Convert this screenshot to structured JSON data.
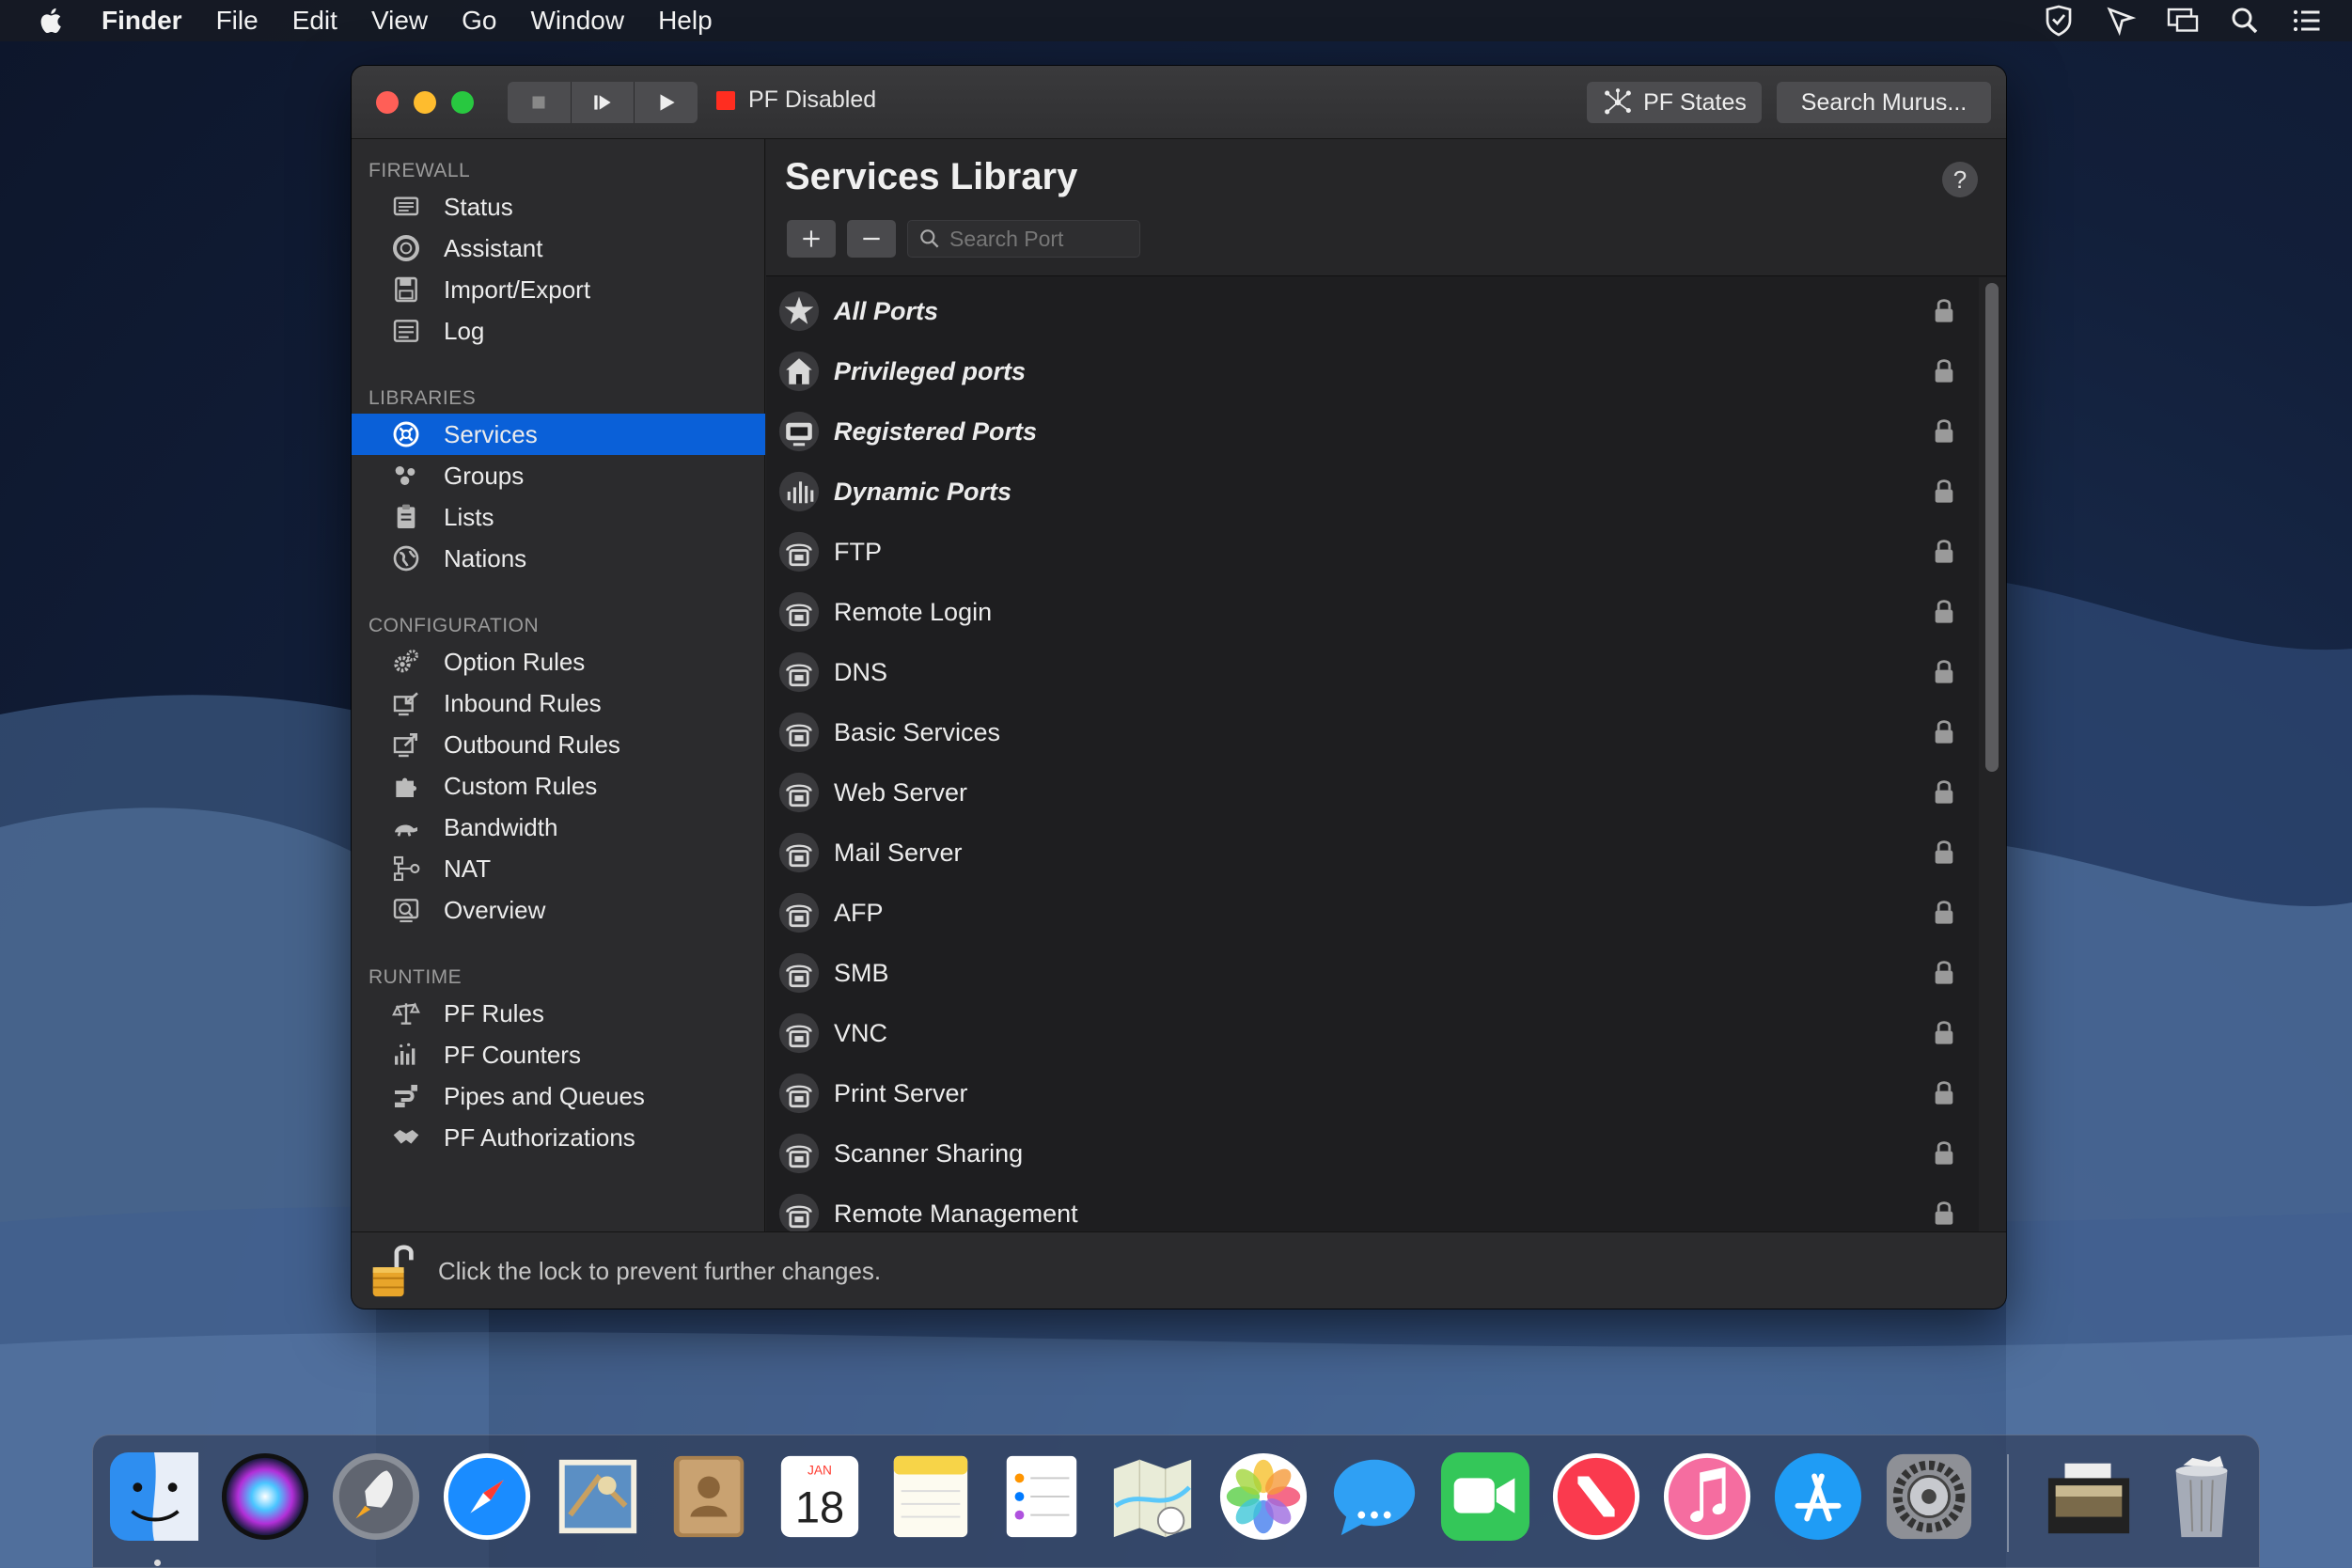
{
  "menubar": {
    "app_name": "Finder",
    "items": [
      "File",
      "Edit",
      "View",
      "Go",
      "Window",
      "Help"
    ]
  },
  "window": {
    "status_text": "PF Disabled",
    "pf_states_label": "PF States",
    "search_label": "Search Murus..."
  },
  "sidebar": {
    "sections": {
      "firewall": "FIREWALL",
      "libraries": "LIBRARIES",
      "configuration": "CONFIGURATION",
      "runtime": "RUNTIME"
    },
    "firewall_items": [
      "Status",
      "Assistant",
      "Import/Export",
      "Log"
    ],
    "libraries_items": [
      "Services",
      "Groups",
      "Lists",
      "Nations"
    ],
    "configuration_items": [
      "Option Rules",
      "Inbound Rules",
      "Outbound Rules",
      "Custom Rules",
      "Bandwidth",
      "NAT",
      "Overview"
    ],
    "runtime_items": [
      "PF Rules",
      "PF Counters",
      "Pipes and Queues",
      "PF Authorizations"
    ],
    "selected": "Services"
  },
  "main": {
    "title": "Services Library",
    "help_label": "?",
    "search_placeholder": "Search Port",
    "services": [
      {
        "label": "All Ports",
        "special": true
      },
      {
        "label": "Privileged ports",
        "special": true
      },
      {
        "label": "Registered Ports",
        "special": true
      },
      {
        "label": "Dynamic Ports",
        "special": true
      },
      {
        "label": "FTP",
        "special": false
      },
      {
        "label": "Remote Login",
        "special": false
      },
      {
        "label": "DNS",
        "special": false
      },
      {
        "label": "Basic Services",
        "special": false
      },
      {
        "label": "Web Server",
        "special": false
      },
      {
        "label": "Mail Server",
        "special": false
      },
      {
        "label": "AFP",
        "special": false
      },
      {
        "label": "SMB",
        "special": false
      },
      {
        "label": "VNC",
        "special": false
      },
      {
        "label": "Print Server",
        "special": false
      },
      {
        "label": "Scanner Sharing",
        "special": false
      },
      {
        "label": "Remote Management",
        "special": false
      }
    ]
  },
  "footer": {
    "text": "Click the lock to prevent further changes."
  },
  "dock": {
    "calendar_month": "JAN",
    "calendar_day": "18",
    "apps": [
      "finder-icon",
      "siri-icon",
      "launchpad-icon",
      "safari-icon",
      "mail-icon",
      "contacts-icon",
      "calendar-icon",
      "notes-icon",
      "reminders-icon",
      "maps-icon",
      "photos-icon",
      "messages-icon",
      "facetime-icon",
      "news-icon",
      "music-icon",
      "app-store-icon",
      "system-preferences-icon",
      "downloads-stack-icon",
      "trash-icon"
    ]
  }
}
